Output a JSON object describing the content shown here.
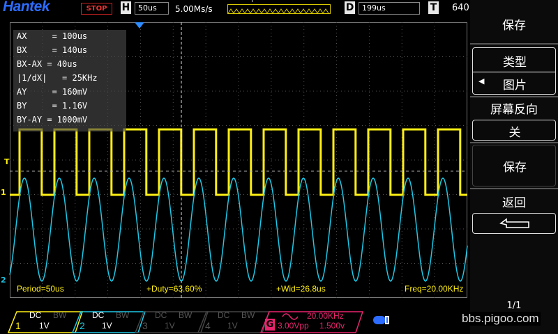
{
  "brand": "Hantek",
  "status": "STOP",
  "timebase": {
    "label": "H",
    "value": "50us",
    "sample_rate": "5.00Ms/s",
    "trigger_marker": "T"
  },
  "delay": {
    "label": "D",
    "value": "199us"
  },
  "trigger_box": {
    "label": "T",
    "value": "640"
  },
  "cursors": [
    {
      "label": "AX     = 100us"
    },
    {
      "label": "BX     = 140us"
    },
    {
      "label": "BX-AX = 40us"
    },
    {
      "label": "|1/dX|   = 25KHz"
    },
    {
      "label": "AY     = 160mV"
    },
    {
      "label": "BY     = 1.16V"
    },
    {
      "label": "BY-AY = 1000mV"
    }
  ],
  "markers": {
    "trigger_level": "T",
    "ch1": "1",
    "ch2": "2"
  },
  "measurements": {
    "period": "Period=50us",
    "duty": "+Duty=63.60%",
    "width": "+Wid=26.8us",
    "freq": "Freq=20.00KHz"
  },
  "menu": {
    "title": "保存",
    "type_label": "类型",
    "type_value": "图片",
    "invert_label": "屏幕反向",
    "invert_value": "关",
    "save_button": "保存",
    "back_label": "返回",
    "page": "1/1"
  },
  "channels": [
    {
      "num": "1",
      "coupling": "DC",
      "bw": "BW",
      "scale": "1V",
      "color": "#ffef14",
      "active": true
    },
    {
      "num": "2",
      "coupling": "DC",
      "bw": "BW",
      "scale": "1V",
      "color": "#1ec8e6",
      "active": true
    },
    {
      "num": "3",
      "coupling": "DC",
      "bw": "BW",
      "scale": "1V",
      "color": "#555555",
      "active": false
    },
    {
      "num": "4",
      "coupling": "DC",
      "bw": "BW",
      "scale": "1V",
      "color": "#555555",
      "active": false
    }
  ],
  "generator": {
    "label": "G",
    "freq": "20.00KHz",
    "amplitude": "3.00Vpp",
    "offset": "1.500v",
    "color": "#e8246e"
  },
  "watermark": "bbs.pigoo.com",
  "colors": {
    "ch1": "#ffef14",
    "ch2": "#1ec8e6",
    "brand": "#2d6cff",
    "stop": "#e33333"
  }
}
